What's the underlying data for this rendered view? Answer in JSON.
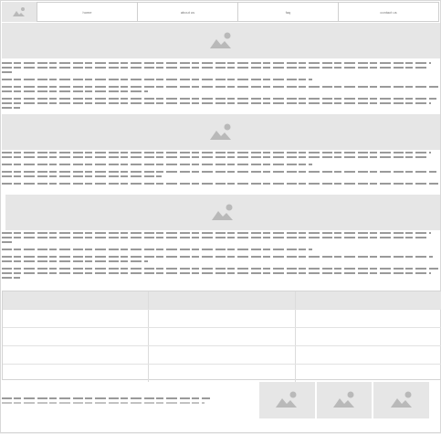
{
  "nav": {
    "items": [
      {
        "label": "home"
      },
      {
        "label": "about us"
      },
      {
        "label": "faq"
      },
      {
        "label": "contact us"
      }
    ]
  },
  "icons": {
    "image": "image-placeholder-icon"
  },
  "colors": {
    "placeholder_fill": "#e6e6e6",
    "placeholder_icon": "#b9b9b9",
    "text_line": "#9a9a9a"
  }
}
